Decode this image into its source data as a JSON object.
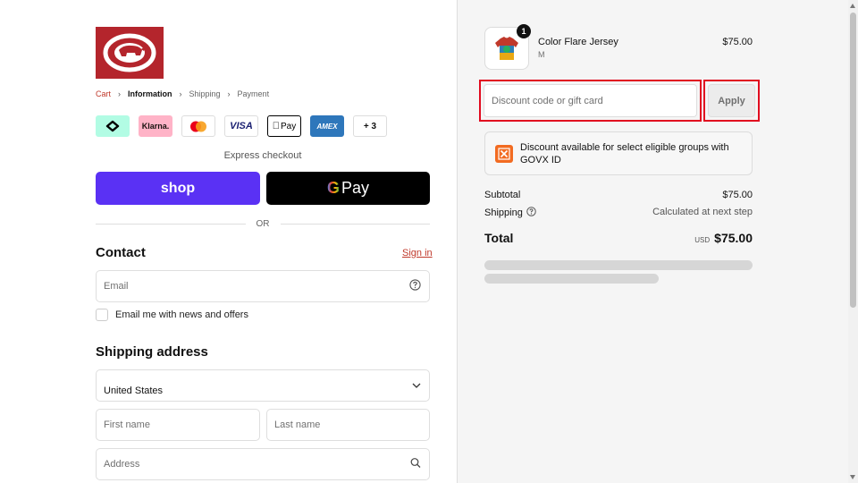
{
  "breadcrumb": {
    "items": [
      {
        "label": "Cart",
        "state": "link"
      },
      {
        "label": "Information",
        "state": "active"
      },
      {
        "label": "Shipping",
        "state": "inactive"
      },
      {
        "label": "Payment",
        "state": "inactive"
      }
    ]
  },
  "payment_methods": {
    "klarna_label": "Klarna.",
    "visa_label": "VISA",
    "applepay_label": "Pay",
    "amex_label": "AMEX",
    "more_label": "+ 3"
  },
  "express": {
    "label": "Express checkout",
    "shop_label": "shop",
    "gpay_g": "G",
    "gpay_label": "Pay",
    "or_label": "OR"
  },
  "contact": {
    "title": "Contact",
    "signin_label": "Sign in",
    "email_placeholder": "Email",
    "newsletter_label": "Email me with news and offers"
  },
  "shipping": {
    "title": "Shipping address",
    "country_value": "United States",
    "first_name_placeholder": "First name",
    "last_name_placeholder": "Last name",
    "address_placeholder": "Address"
  },
  "order": {
    "product": {
      "name": "Color Flare Jersey",
      "variant": "M",
      "price": "$75.00",
      "quantity": "1"
    },
    "discount_placeholder": "Discount code or gift card",
    "apply_label": "Apply",
    "govx_text": "Discount available for select eligible groups with GOVX ID",
    "subtotal_label": "Subtotal",
    "subtotal_value": "$75.00",
    "shipping_label": "Shipping",
    "shipping_value": "Calculated at next step",
    "total_label": "Total",
    "total_currency": "USD",
    "total_value": "$75.00"
  },
  "colors": {
    "brand_red": "#b4252c",
    "shop_purple": "#5a31f4",
    "highlight_red": "#e10a1f",
    "link_red": "#c0392b"
  }
}
